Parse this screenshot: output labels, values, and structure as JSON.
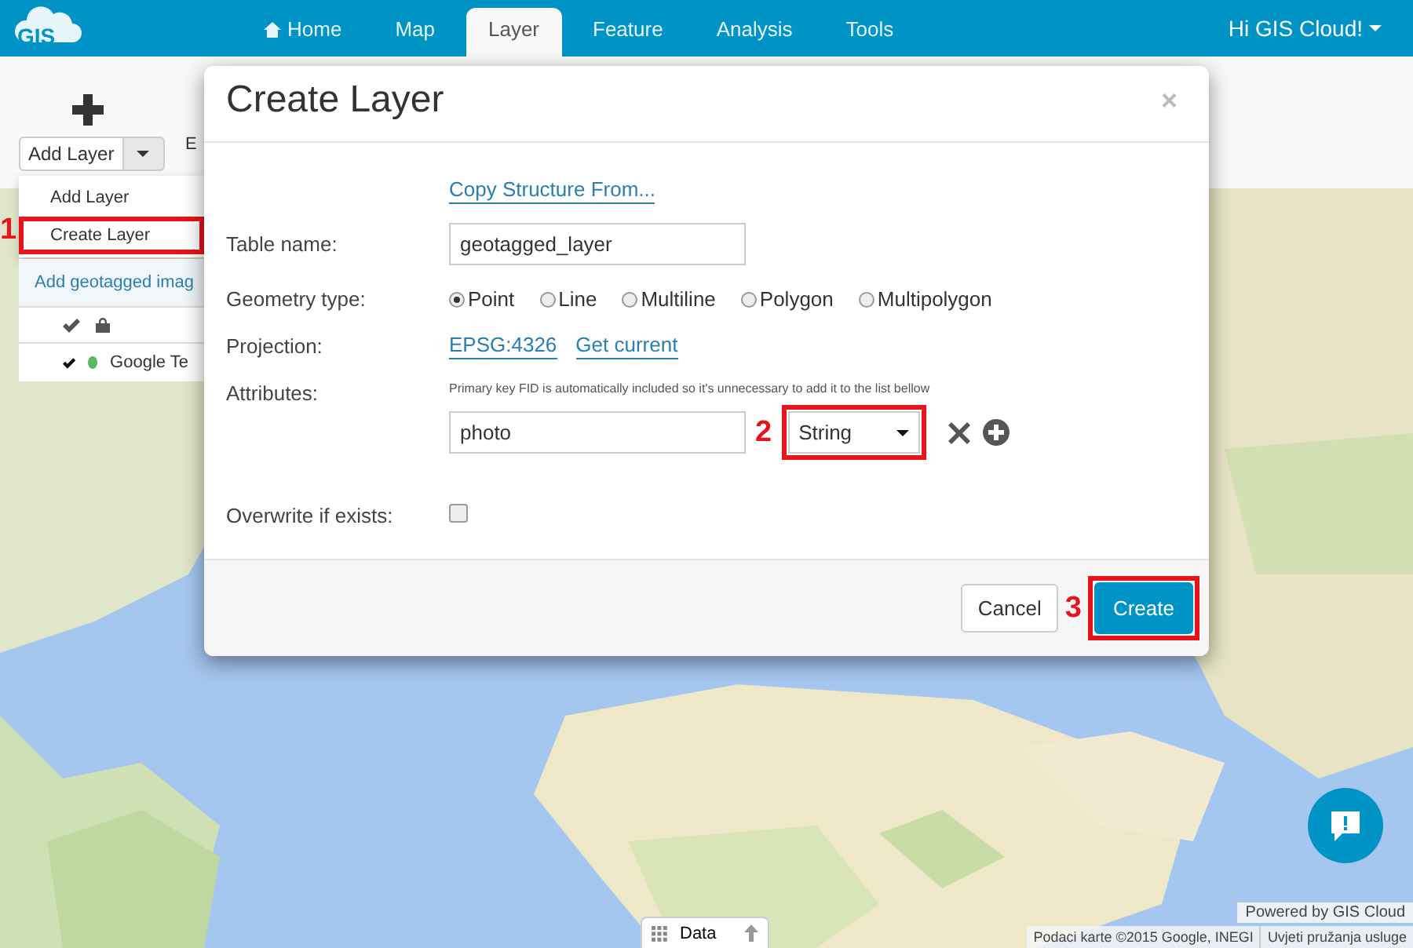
{
  "header": {
    "logo": "GIS",
    "nav": [
      {
        "label": "Home",
        "selected": false,
        "kind": "home"
      },
      {
        "label": "Map",
        "selected": false
      },
      {
        "label": "Layer",
        "selected": true
      },
      {
        "label": "Feature",
        "selected": false
      },
      {
        "label": "Analysis",
        "selected": false
      },
      {
        "label": "Tools",
        "selected": false
      }
    ],
    "user": "Hi GIS Cloud!"
  },
  "toolbar": {
    "add_button": "Add Layer",
    "cut_label": "E"
  },
  "add_menu": {
    "items": [
      {
        "label": "Add Layer",
        "selected": false
      },
      {
        "label": "Create Layer",
        "selected": true
      }
    ],
    "step": "1"
  },
  "layers_panel": {
    "link": "Add geotagged imag",
    "rows": [
      {
        "name": "Google Te",
        "visible": true,
        "color": "#5cb85c"
      }
    ]
  },
  "dialog": {
    "title": "Create Layer",
    "close": "×",
    "copy_link": "Copy Structure From...",
    "table_name": {
      "label": "Table name:",
      "value": "geotagged_layer"
    },
    "geometry": {
      "label": "Geometry type:",
      "options": [
        {
          "label": "Point",
          "selected": true
        },
        {
          "label": "Line",
          "selected": false
        },
        {
          "label": "Multiline",
          "selected": false
        },
        {
          "label": "Polygon",
          "selected": false
        },
        {
          "label": "Multipolygon",
          "selected": false
        }
      ]
    },
    "projection": {
      "label": "Projection:",
      "links": [
        "EPSG:4326",
        "Get current"
      ]
    },
    "attributes": {
      "label": "Attributes:",
      "hint": "Primary key FID is automatically included so it's unnecessary to add it to the list bellow",
      "rows": [
        {
          "name": "photo",
          "type": "String"
        }
      ],
      "step": "2"
    },
    "overwrite": {
      "label": "Overwrite if exists:",
      "checked": false
    },
    "cancel": "Cancel",
    "create": "Create",
    "step": "3"
  },
  "data_tab": "Data",
  "powered_by": "Powered by GIS Cloud",
  "attribution": [
    "Podaci karte ©2015 Google, INEGI",
    "Uvjeti pružanja usluge"
  ]
}
